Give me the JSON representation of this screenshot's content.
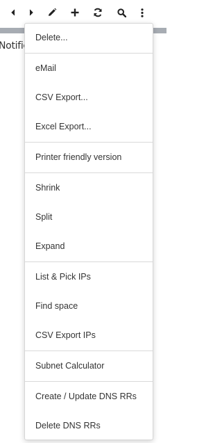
{
  "toolbar": {
    "icons": [
      "chevron-left-icon",
      "chevron-right-icon",
      "pencil-icon",
      "plus-icon",
      "refresh-icon",
      "search-icon",
      "kebab-menu-icon"
    ]
  },
  "background": {
    "tab_label": "Notific"
  },
  "menu": {
    "groups": [
      [
        "Delete..."
      ],
      [
        "eMail",
        "CSV Export...",
        "Excel Export..."
      ],
      [
        "Printer friendly version"
      ],
      [
        "Shrink",
        "Split",
        "Expand"
      ],
      [
        "List & Pick IPs",
        "Find space",
        "CSV Export IPs"
      ],
      [
        "Subnet Calculator"
      ],
      [
        "Create / Update DNS RRs",
        "Delete DNS RRs"
      ]
    ],
    "items": {
      "delete": "Delete...",
      "email": "eMail",
      "csv_export": "CSV Export...",
      "excel_export": "Excel Export...",
      "printer_friendly": "Printer friendly version",
      "shrink": "Shrink",
      "split": "Split",
      "expand": "Expand",
      "list_pick_ips": "List & Pick IPs",
      "find_space": "Find space",
      "csv_export_ips": "CSV Export IPs",
      "subnet_calculator": "Subnet Calculator",
      "create_update_dns": "Create / Update DNS RRs",
      "delete_dns": "Delete DNS RRs"
    }
  },
  "colors": {
    "text": "#333333",
    "divider": "#d9d9d9",
    "background_bar": "#a7acb3"
  }
}
